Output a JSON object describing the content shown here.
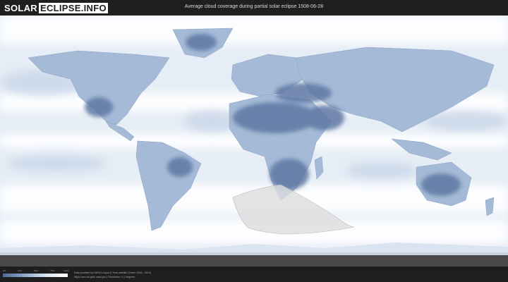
{
  "header": {
    "logo_left": "SOLAR",
    "logo_right": "ECLIPSE.INFO",
    "title": "Average cloud coverage during partial solar eclipse 1508-06-28"
  },
  "map": {
    "ocean_color": "#e6edf6",
    "cloud_color": "#ffffff",
    "clear_land_color": "#5f78a3",
    "land_color": "#a4bad6",
    "eclipse_area_color": "#dcdcdc",
    "antarctica_color": "#4a4a4a"
  },
  "legend": {
    "labels": [
      "0%",
      "25%",
      "50%",
      "75%",
      "100%"
    ]
  },
  "footer": {
    "credit_line1": "Data provided by NASA's Aqua & Terra satellite (Years: 2000 - 2019)",
    "credit_line2": "https://neo.sci.gsfc.nasa.gov | Resolution: 0.1 degrees"
  }
}
